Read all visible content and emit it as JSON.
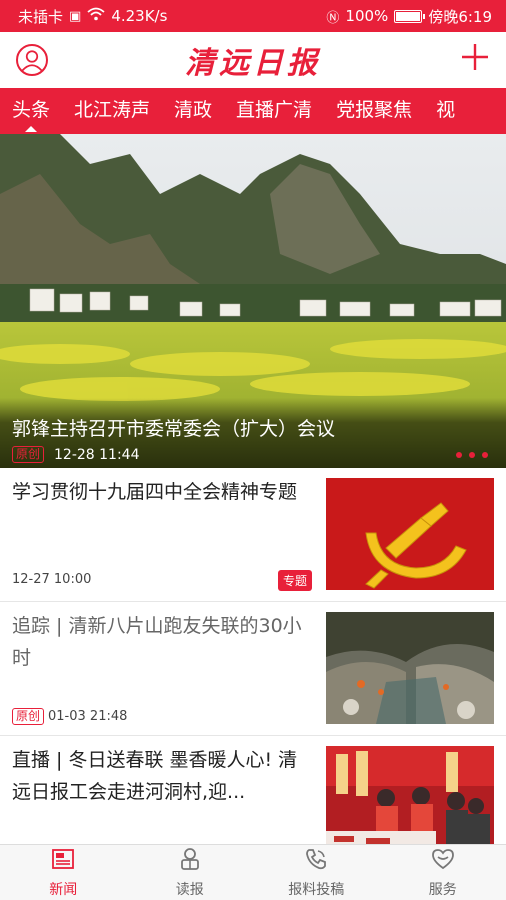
{
  "status": {
    "carrier": "未插卡",
    "speed": "4.23K/s",
    "battery": "100%",
    "battery_level": 1.0,
    "time": "傍晚6:19"
  },
  "header": {
    "logo": "清远日报"
  },
  "tabs": [
    {
      "label": "头条"
    },
    {
      "label": "北江涛声"
    },
    {
      "label": "清政"
    },
    {
      "label": "直播广清"
    },
    {
      "label": "党报聚焦"
    },
    {
      "label": "视"
    }
  ],
  "hero": {
    "title": "郭锋主持召开市委常委会（扩大）会议",
    "tag": "原创",
    "time": "12-28 11:44"
  },
  "news": [
    {
      "title": "学习贯彻十九届四中全会精神专题",
      "time": "12-27 10:00",
      "badge": "专题"
    },
    {
      "title": "追踪 | 清新八片山跑友失联的30小时",
      "tag": "原创",
      "time": "01-03 21:48"
    },
    {
      "title": "直播 | 冬日送春联  墨香暖人心! 清远日报工会走进河洞村,迎..."
    }
  ],
  "bottom_nav": [
    {
      "label": "新闻",
      "icon": "newspaper-icon"
    },
    {
      "label": "读报",
      "icon": "reader-icon"
    },
    {
      "label": "报料投稿",
      "icon": "phone-icon"
    },
    {
      "label": "服务",
      "icon": "heart-icon"
    }
  ],
  "colors": {
    "accent": "#e8203a"
  }
}
